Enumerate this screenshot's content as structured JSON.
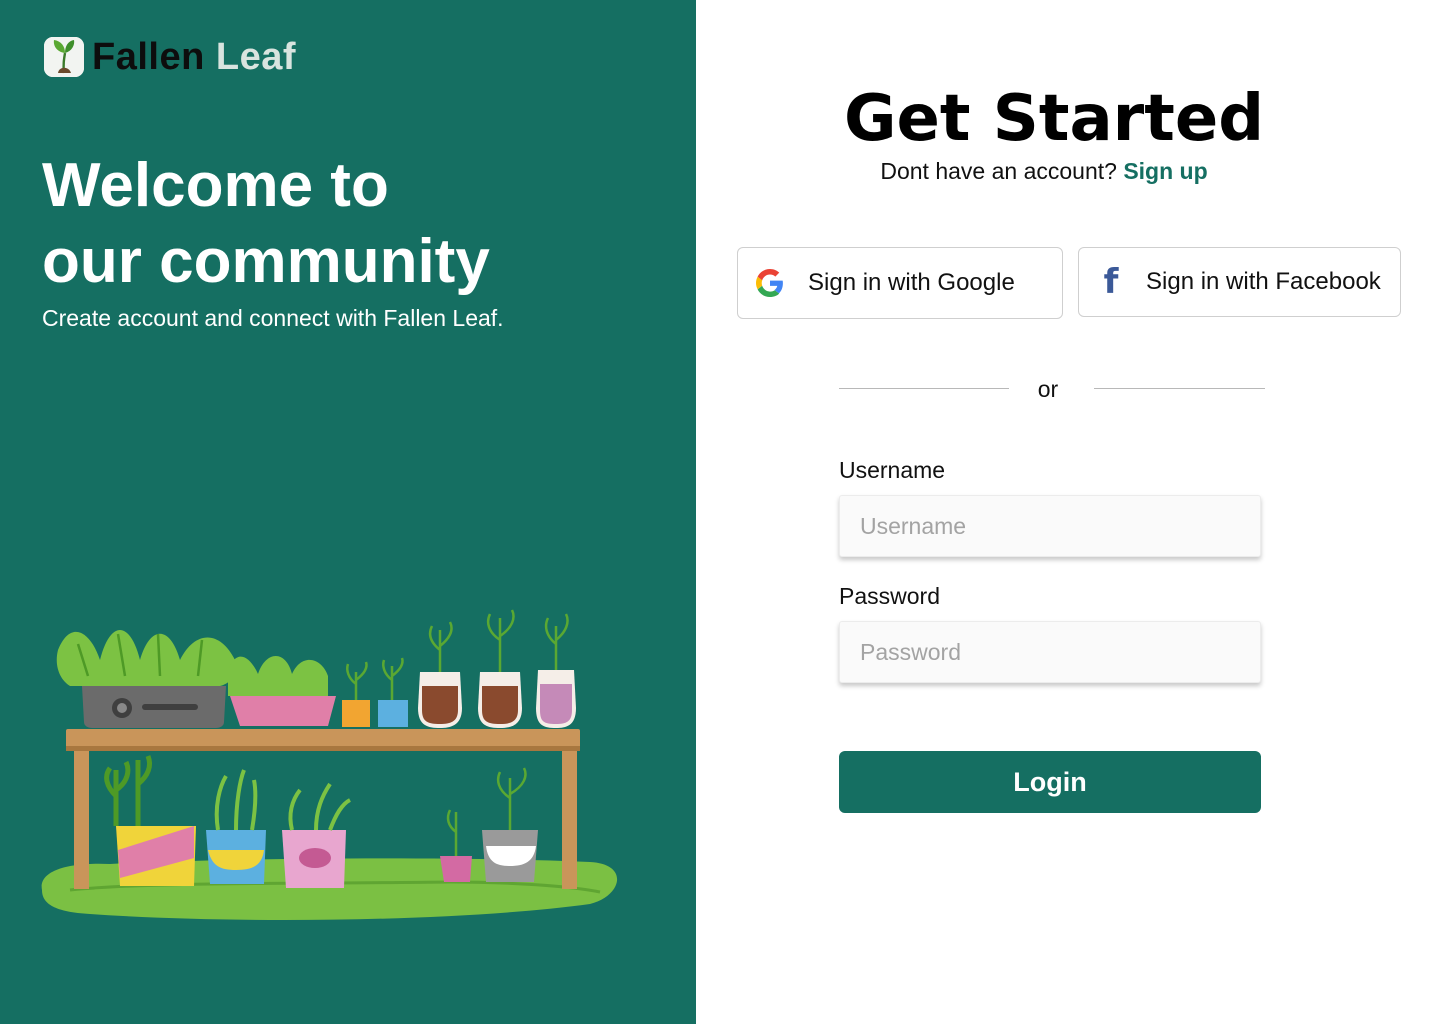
{
  "brand": {
    "name_part1": "Fallen",
    "name_part2": "Leaf"
  },
  "hero": {
    "headline_line1": "Welcome to",
    "headline_line2": "our community",
    "tagline": "Create account and connect with Fallen Leaf."
  },
  "form": {
    "title": "Get Started",
    "subtitle_prefix": "Dont have an account?",
    "signup_link": "Sign up",
    "google_button": "Sign in with Google",
    "facebook_button": "Sign in with Facebook",
    "divider": "or",
    "username_label": "Username",
    "username_placeholder": "Username",
    "password_label": "Password",
    "password_placeholder": "Password",
    "login_button": "Login"
  },
  "colors": {
    "brand_green": "#156f62",
    "facebook_blue": "#3b5998"
  },
  "icons": {
    "logo": "sprout-logo-icon",
    "google": "google-g-icon",
    "facebook": "facebook-f-icon"
  }
}
